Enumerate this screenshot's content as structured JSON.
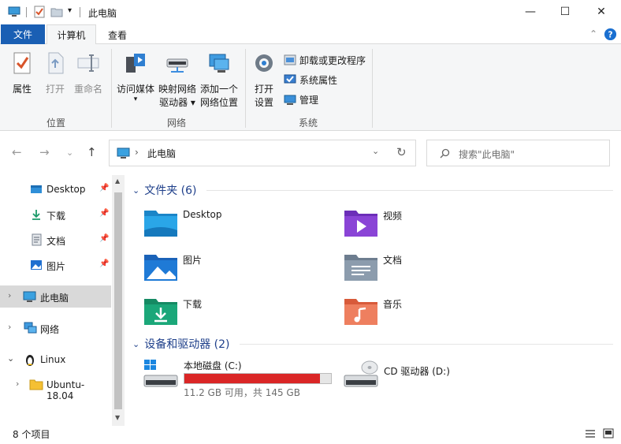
{
  "window": {
    "title": "此电脑",
    "minimize": "—",
    "maximize": "☐",
    "close": "✕"
  },
  "tabs": {
    "file": "文件",
    "computer": "计算机",
    "view": "查看"
  },
  "ribbon": {
    "location": {
      "group": "位置",
      "properties": "属性",
      "open": "打开",
      "rename": "重命名"
    },
    "network": {
      "group": "网络",
      "access_media": "访问媒体",
      "map_drive_line1": "映射网络",
      "map_drive_line2": "驱动器 ▾",
      "add_location_line1": "添加一个",
      "add_location_line2": "网络位置"
    },
    "system": {
      "group": "系统",
      "open_settings_line1": "打开",
      "open_settings_line2": "设置",
      "uninstall": "卸载或更改程序",
      "system_properties": "系统属性",
      "manage": "管理"
    }
  },
  "address": {
    "path": "此电脑",
    "search_placeholder": "搜索\"此电脑\""
  },
  "nav": {
    "quick_access": [
      {
        "label": "Desktop"
      },
      {
        "label": "下载"
      },
      {
        "label": "文档"
      },
      {
        "label": "图片"
      }
    ],
    "this_pc": "此电脑",
    "network": "网络",
    "linux": "Linux",
    "ubuntu": "Ubuntu-18.04"
  },
  "content": {
    "folders_header": "文件夹 (6)",
    "folders": [
      {
        "name": "Desktop"
      },
      {
        "name": "视频"
      },
      {
        "name": "图片"
      },
      {
        "name": "文档"
      },
      {
        "name": "下载"
      },
      {
        "name": "音乐"
      }
    ],
    "devices_header": "设备和驱动器 (2)",
    "local_disk": {
      "name": "本地磁盘 (C:)",
      "detail": "11.2 GB 可用，共 145 GB",
      "used_fraction": 0.923
    },
    "cd_drive": {
      "name": "CD 驱动器 (D:)"
    }
  },
  "status": {
    "item_count": "8 个项目"
  },
  "colors": {
    "accent": "#1a5fb4",
    "section_header": "#1e3f8a",
    "disk_bar_full": "#da2626"
  }
}
